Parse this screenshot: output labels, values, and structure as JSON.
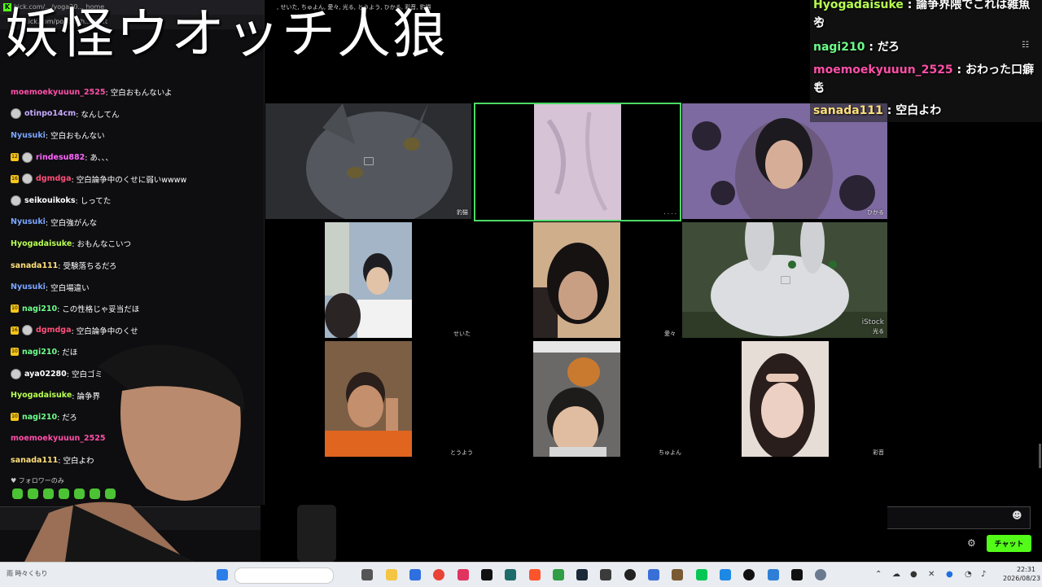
{
  "browser": {
    "tab_text": "kick.com/.../yoga20... home",
    "url": "kick.com/popout/h.../chat"
  },
  "overlay_title": "妖怪ウオッチ人狼",
  "participants_text": ", せいた, ちゅよん, 愛々, 光る, とうよう, ひかる, 彩音, 豹猫",
  "left_chat": {
    "messages": [
      {
        "user": "moemoekyuuun_2525",
        "text": ": 空白おもんないよ",
        "color": "#ff4fa8",
        "badge": "",
        "avatar": false
      },
      {
        "user": "otinpo14cm",
        "text": ": なんしてん",
        "color": "#c5a8ff",
        "badge": "",
        "avatar": true
      },
      {
        "user": "Nyusuki",
        "text": ": 空白おもんない",
        "color": "#7aa5ff",
        "badge": "",
        "avatar": false
      },
      {
        "user": "rindesu882",
        "text": ": あ、、、",
        "color": "#ff66ff",
        "badge": "12",
        "avatar": true
      },
      {
        "user": "dgmdga",
        "text": ": 空白論争中のくせに弱いwwww",
        "color": "#ff4f7a",
        "badge": "16",
        "avatar": true
      },
      {
        "user": "seikouikoks",
        "text": ": しってた",
        "color": "#ffffff",
        "badge": "",
        "avatar": true
      },
      {
        "user": "Nyusuki",
        "text": ": 空白強がんな",
        "color": "#7aa5ff",
        "badge": "",
        "avatar": false
      },
      {
        "user": "Hyogadaisuke",
        "text": ": おもんなこいつ",
        "color": "#b8ff4f",
        "badge": "",
        "avatar": false
      },
      {
        "user": "sanada111",
        "text": ": 受験落ちるだろ",
        "color": "#ffe07a",
        "badge": "",
        "avatar": false
      },
      {
        "user": "Nyusuki",
        "text": ": 空白場違い",
        "color": "#7aa5ff",
        "badge": "",
        "avatar": false
      },
      {
        "user": "nagi210",
        "text": ": この性格じゃ妥当だほ",
        "color": "#6dff8a",
        "badge": "10",
        "avatar": false
      },
      {
        "user": "dgmdga",
        "text": ": 空白論争中のくせ",
        "color": "#ff4f7a",
        "badge": "16",
        "avatar": true
      },
      {
        "user": "nagi210",
        "text": ": だほ",
        "color": "#6dff8a",
        "badge": "10",
        "avatar": false
      },
      {
        "user": "aya02280",
        "text": ": 空白ゴミ",
        "color": "#ffffff",
        "badge": "",
        "avatar": true
      },
      {
        "user": "Hyogadaisuke",
        "text": ": 論争界",
        "color": "#b8ff4f",
        "badge": "",
        "avatar": false
      },
      {
        "user": "nagi210",
        "text": ": だろ",
        "color": "#6dff8a",
        "badge": "10",
        "avatar": false
      },
      {
        "user": "moemoekyuuun_2525",
        "text": "",
        "color": "#ff4fa8",
        "badge": "",
        "avatar": false
      },
      {
        "user": "sanada111",
        "text": ": 空白よわ",
        "color": "#ffe07a",
        "badge": "",
        "avatar": false
      }
    ],
    "followers_only": "♥ フォロワーのみ"
  },
  "right_chat": {
    "messages": [
      {
        "user": "Hyogadaisuke",
        "text": " : 論争界隈でこれは雑魚や",
        "cont": "ろ",
        "color": "#b8ff4f"
      },
      {
        "user": "nagi210",
        "text": " : だろ",
        "cont": "",
        "color": "#6dff8a"
      },
      {
        "user": "moemoekyuuun_2525",
        "text": " : おわった口癖き",
        "cont": "も",
        "color": "#ff4fa8"
      },
      {
        "user": "sanada111",
        "text": " : 空白よわ",
        "cont": "",
        "color": "#ffe07a"
      }
    ],
    "chat_button": "チャット"
  },
  "video_tiles": [
    {
      "name": "豹猫",
      "desc": "cat"
    },
    {
      "name": "· · · ·",
      "desc": "pink"
    },
    {
      "name": "ひかる",
      "desc": "kuromi"
    },
    {
      "name": "せいた",
      "desc": "boys"
    },
    {
      "name": "愛々",
      "desc": "girl"
    },
    {
      "name": "光る",
      "desc": "rabbit"
    },
    {
      "name": "とうよう",
      "desc": "orange"
    },
    {
      "name": "ちゅよん",
      "desc": "catboy"
    },
    {
      "name": "彩音",
      "desc": "girl2"
    }
  ],
  "watermark": "iStock",
  "taskbar": {
    "weather": "雨 時々くもり",
    "time": "22:31",
    "date": "2026/08/23"
  },
  "colors": {
    "accent": "#53fc18",
    "active_border": "#4cd964"
  }
}
